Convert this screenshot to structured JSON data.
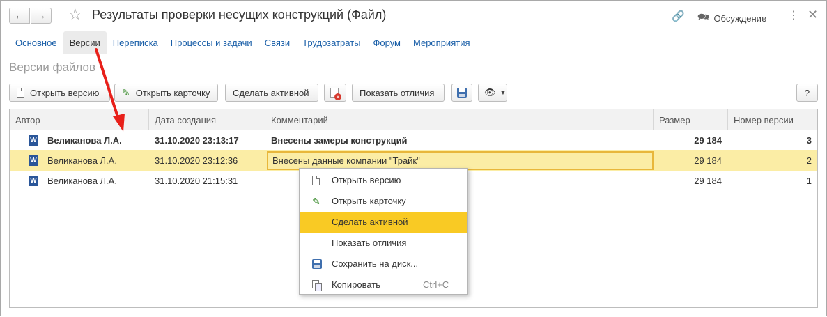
{
  "window": {
    "title": "Результаты проверки несущих конструкций (Файл)",
    "discussion_label": "Обсуждение"
  },
  "tabs": [
    {
      "label": "Основное",
      "active": false
    },
    {
      "label": "Версии",
      "active": true
    },
    {
      "label": "Переписка",
      "active": false
    },
    {
      "label": "Процессы и задачи",
      "active": false
    },
    {
      "label": "Связи",
      "active": false
    },
    {
      "label": "Трудозатраты",
      "active": false
    },
    {
      "label": "Форум",
      "active": false
    },
    {
      "label": "Мероприятия",
      "active": false
    }
  ],
  "section_title": "Версии файлов",
  "toolbar": {
    "open_version": "Открыть версию",
    "open_card": "Открыть карточку",
    "make_active": "Сделать активной",
    "show_diff": "Показать отличия",
    "help": "?"
  },
  "table": {
    "columns": [
      "Автор",
      "Дата создания",
      "Комментарий",
      "Размер",
      "Номер версии"
    ],
    "rows": [
      {
        "author": "Великанова Л.А.",
        "created": "31.10.2020 23:13:17",
        "comment": "Внесены замеры конструкций",
        "size": "29 184",
        "version": "3",
        "active": true,
        "selected": false
      },
      {
        "author": "Великанова Л.А.",
        "created": "31.10.2020 23:12:36",
        "comment": "Внесены данные компании \"Трайк\"",
        "size": "29 184",
        "version": "2",
        "active": false,
        "selected": true
      },
      {
        "author": "Великанова Л.А.",
        "created": "31.10.2020 21:15:31",
        "comment": "",
        "size": "29 184",
        "version": "1",
        "active": false,
        "selected": false
      }
    ]
  },
  "context_menu": {
    "items": [
      {
        "label": "Открыть версию",
        "icon": "document-icon",
        "shortcut": "",
        "highlighted": false
      },
      {
        "label": "Открыть карточку",
        "icon": "pencil-icon",
        "shortcut": "",
        "highlighted": false
      },
      {
        "label": "Сделать активной",
        "icon": "",
        "shortcut": "",
        "highlighted": true
      },
      {
        "label": "Показать отличия",
        "icon": "",
        "shortcut": "",
        "highlighted": false
      },
      {
        "label": "Сохранить на диск...",
        "icon": "save-icon",
        "shortcut": "",
        "highlighted": false
      },
      {
        "label": "Копировать",
        "icon": "copy-icon",
        "shortcut": "Ctrl+C",
        "highlighted": false
      }
    ]
  },
  "colors": {
    "accent_link": "#1a5fa8",
    "selected_row": "#fbeda5",
    "menu_highlight": "#f9ca24",
    "annotation_arrow": "#e8201a"
  }
}
